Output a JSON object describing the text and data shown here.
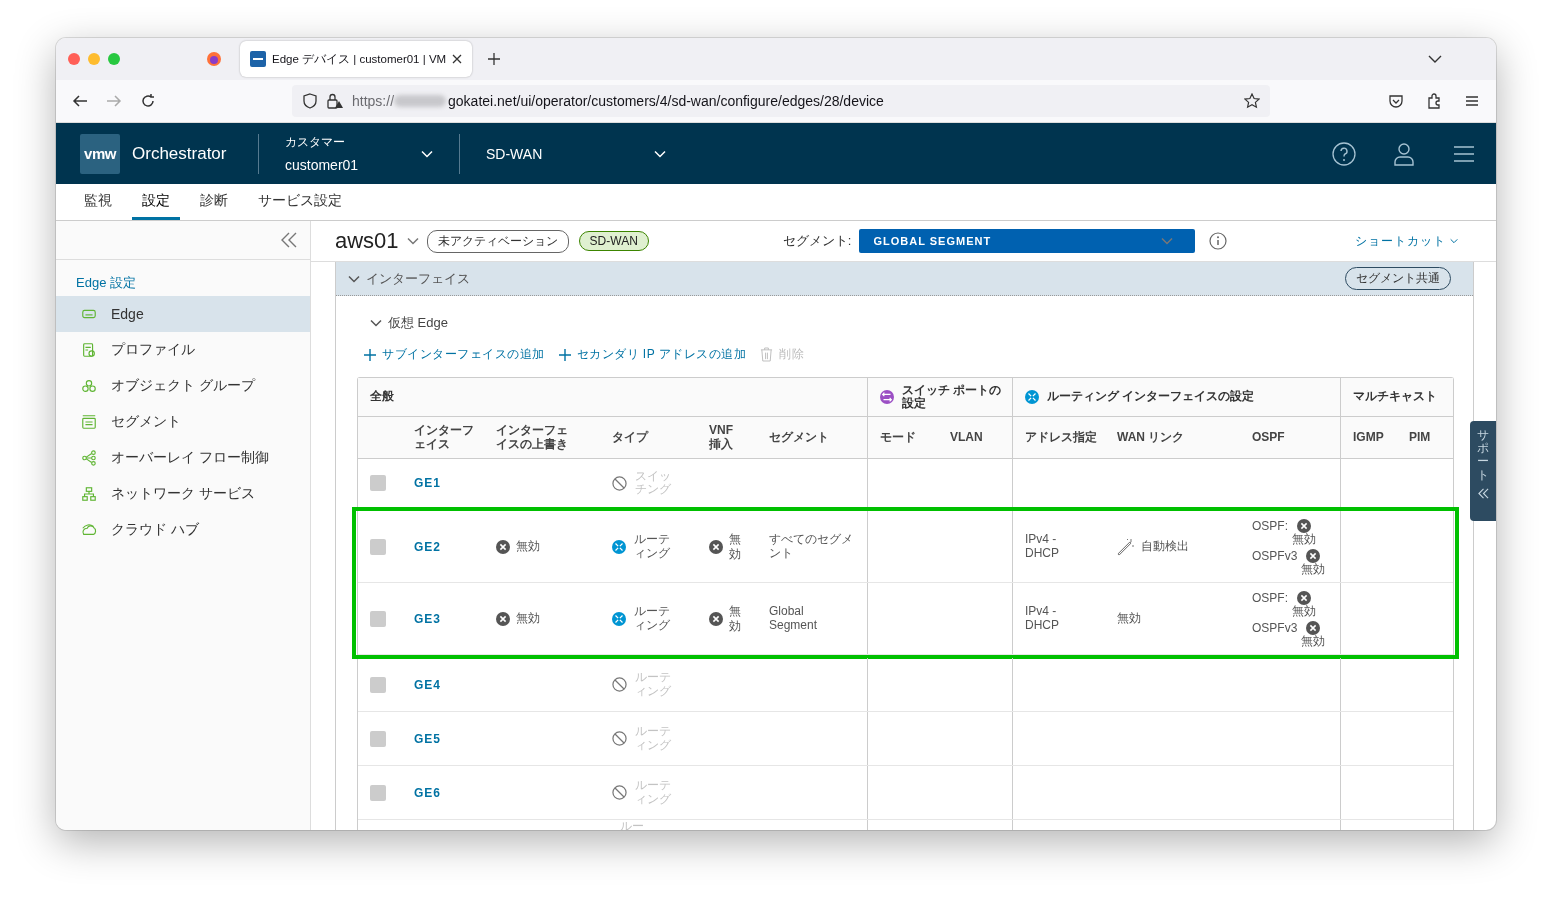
{
  "browser": {
    "tab_title": "Edge デバイス | customer01 | VM",
    "url_scheme": "https://",
    "url_rest": "gokatei.net/ui/operator/customers/4/sd-wan/configure/edges/28/device"
  },
  "header": {
    "logo": "vmw",
    "product": "Orchestrator",
    "customer_label": "カスタマー",
    "customer": "customer01",
    "service": "SD-WAN"
  },
  "nav_tabs": [
    {
      "label": "監視",
      "selected": false
    },
    {
      "label": "設定",
      "selected": true
    },
    {
      "label": "診断",
      "selected": false
    },
    {
      "label": "サービス設定",
      "selected": false
    }
  ],
  "sidebar": {
    "title": "Edge 設定",
    "items": [
      {
        "label": "Edge",
        "selected": true
      },
      {
        "label": "プロファイル",
        "selected": false
      },
      {
        "label": "オブジェクト グループ",
        "selected": false
      },
      {
        "label": "セグメント",
        "selected": false
      },
      {
        "label": "オーバーレイ フロー制御",
        "selected": false
      },
      {
        "label": "ネットワーク サービス",
        "selected": false
      },
      {
        "label": "クラウド ハブ",
        "selected": false
      }
    ]
  },
  "edge_bar": {
    "name": "aws01",
    "status": "未アクティベーション",
    "type": "SD-WAN",
    "segment_label": "セグメント:",
    "segment": "GLOBAL SEGMENT",
    "shortcut": "ショートカット"
  },
  "section": {
    "title": "インターフェイス",
    "badge": "セグメント共通",
    "subsection": "仮想 Edge",
    "actions": [
      {
        "label": "サブインターフェイスの追加",
        "disabled": false
      },
      {
        "label": "セカンダリ IP アドレスの追加",
        "disabled": false
      },
      {
        "label": "削除",
        "disabled": true
      }
    ]
  },
  "table": {
    "groups": [
      {
        "label": "全般"
      },
      {
        "label": "スイッチ ポートの設定"
      },
      {
        "label": "ルーティング インターフェイスの設定"
      },
      {
        "label": "マルチキャスト"
      }
    ],
    "columns": [
      "インターフェイス",
      "インターフェイスの上書き",
      "タイプ",
      "VNF 挿入",
      "セグメント",
      "モード",
      "VLAN",
      "アドレス指定",
      "WAN リンク",
      "OSPF",
      "IGMP",
      "PIM"
    ],
    "rows": [
      {
        "name": "GE1",
        "checked": false,
        "type": {
          "text": "スイッチング",
          "enabled": false
        }
      },
      {
        "name": "GE2",
        "checked": false,
        "override": "無効",
        "type": {
          "text": "ルーティング",
          "enabled": true
        },
        "vnf": "無効",
        "segment": "すべてのセグメント",
        "address": "IPv4 - DHCP",
        "wan": {
          "text": "自動検出",
          "auto": true
        },
        "ospf": [
          {
            "label": "OSPF:",
            "value": "無効"
          },
          {
            "label": "OSPFv3",
            "value": "無効"
          }
        ],
        "highlighted": true
      },
      {
        "name": "GE3",
        "checked": false,
        "override": "無効",
        "type": {
          "text": "ルーティング",
          "enabled": true
        },
        "vnf": "無効",
        "segment": "Global Segment",
        "address": "IPv4 - DHCP",
        "wan": {
          "text": "無効",
          "auto": false
        },
        "ospf": [
          {
            "label": "OSPF:",
            "value": "無効"
          },
          {
            "label": "OSPFv3",
            "value": "無効"
          }
        ],
        "highlighted": true
      },
      {
        "name": "GE4",
        "checked": false,
        "type": {
          "text": "ルーティング",
          "enabled": false
        }
      },
      {
        "name": "GE5",
        "checked": false,
        "type": {
          "text": "ルーティング",
          "enabled": false
        }
      },
      {
        "name": "GE6",
        "checked": false,
        "type": {
          "text": "ルーティング",
          "enabled": false
        }
      },
      {
        "type": {
          "text": "ルー",
          "enabled": false
        },
        "cut": true
      }
    ]
  },
  "support_tab": "サポート"
}
